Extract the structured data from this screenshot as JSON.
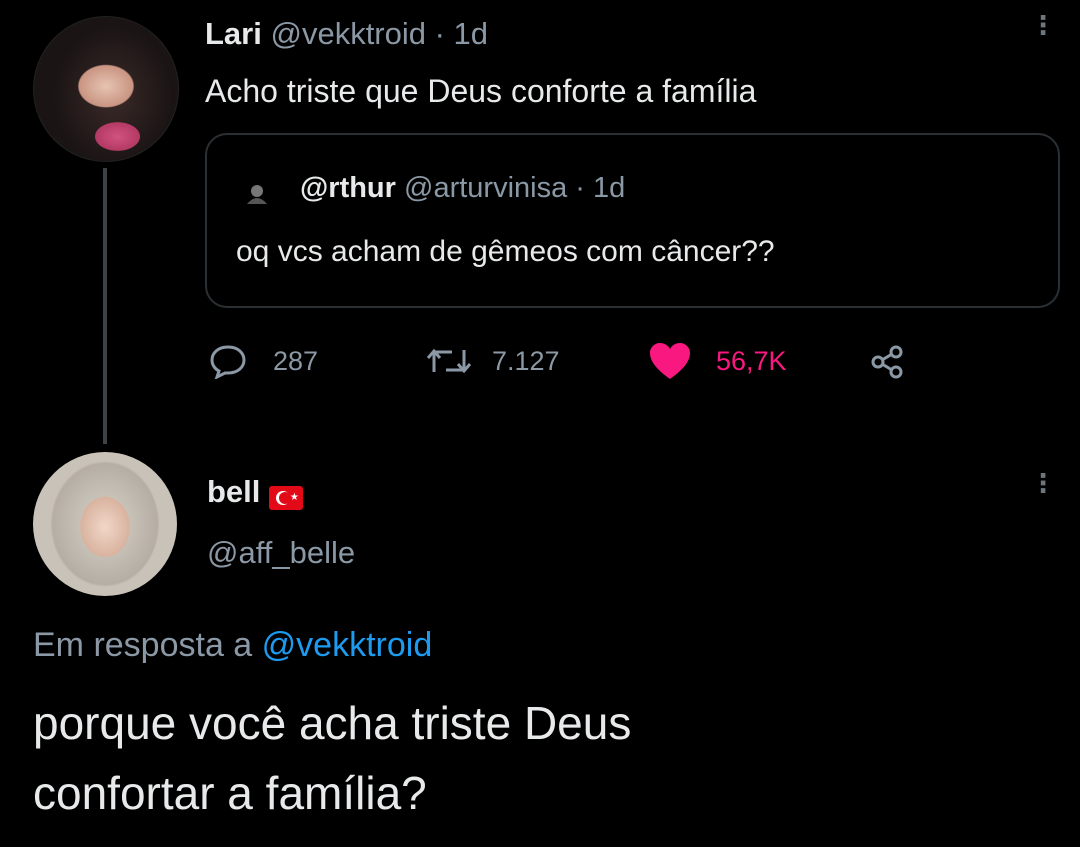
{
  "tweet": {
    "author_name": "Lari",
    "author_handle": "@vekktroid",
    "time": "· 1d",
    "text": "Acho triste que Deus conforte a família",
    "quoted": {
      "author_name": "@rthur",
      "author_handle": "@arturvinisa",
      "time": "· 1d",
      "text": "oq vcs acham de gêmeos com câncer??"
    },
    "stats": {
      "replies": "287",
      "retweets": "7.127",
      "likes": "56,7K"
    },
    "colors": {
      "like": "#f91880",
      "muted": "#8b98a5",
      "link": "#1d9bf0"
    }
  },
  "reply": {
    "author_name": "bell",
    "author_handle": "@aff_belle",
    "in_reply_to_prefix": "Em resposta a",
    "in_reply_to_handle": "@vekktroid",
    "text_line1": "porque você acha triste Deus",
    "text_line2": "confortar a família?"
  },
  "icons": [
    "more-icon",
    "reply-icon",
    "retweet-icon",
    "like-icon",
    "share-icon",
    "turkey-flag-icon"
  ]
}
